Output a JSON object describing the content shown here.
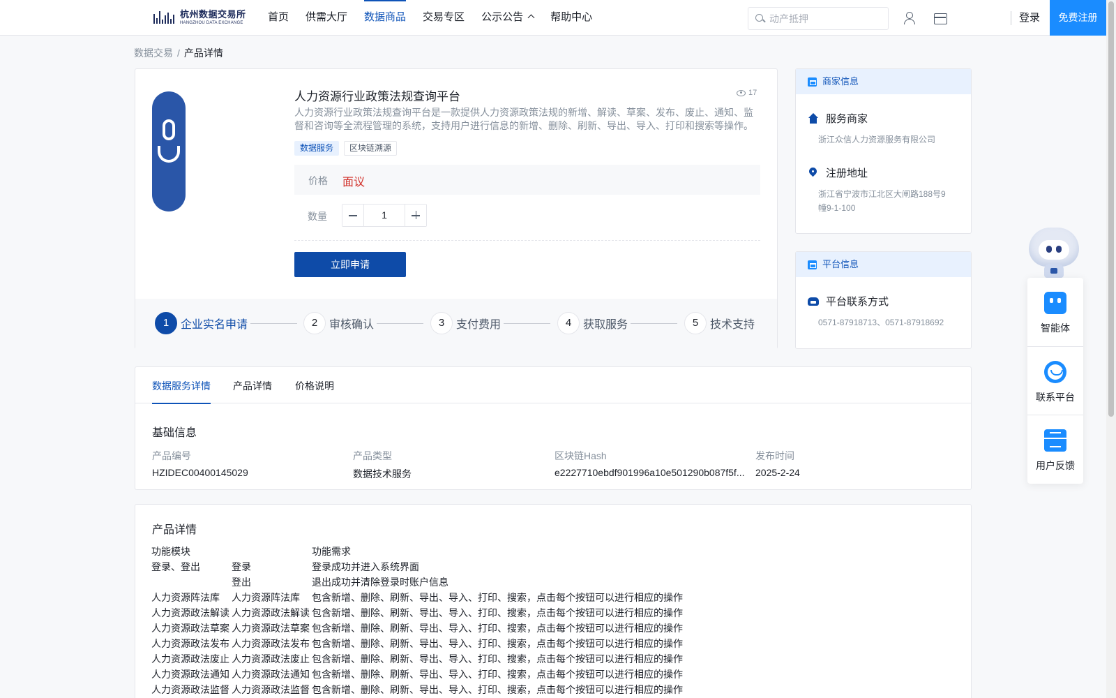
{
  "header": {
    "logo": {
      "cn": "杭州数据交易所",
      "en": "HANGZHOU DATA EXCHANGE"
    },
    "nav": [
      {
        "label": "首页"
      },
      {
        "label": "供需大厅"
      },
      {
        "label": "数据商品",
        "active": true
      },
      {
        "label": "交易专区"
      },
      {
        "label": "公示公告"
      },
      {
        "label": "帮助中心"
      }
    ],
    "search": {
      "placeholder": "动产抵押",
      "value": ""
    },
    "login": "登录",
    "register": "免费注册",
    "accent_color": "#0e53b8",
    "register_color": "#1a8cff"
  },
  "breadcrumb": {
    "root": "数据交易",
    "separator": "/",
    "current": "产品详情"
  },
  "product": {
    "title": "人力资源行业政策法规查询平台",
    "views": "17",
    "description": "人力资源行业政策法规查询平台是一款提供人力资源政策法规的新增、解读、草案、发布、废止、通知、监督和咨询等全流程管理的系统，支持用户进行信息的新增、删除、刷新、导出、导入、打印和搜索等操作。",
    "tags": [
      "数据服务",
      "区块链溯源"
    ],
    "price_label": "价格",
    "price_value": "面议",
    "price_color": "#d2312a",
    "quantity_label": "数量",
    "quantity": "1",
    "apply_button": "立即申请",
    "steps": [
      {
        "num": "1",
        "label": "企业实名申请",
        "active": true
      },
      {
        "num": "2",
        "label": "审核确认"
      },
      {
        "num": "3",
        "label": "支付费用"
      },
      {
        "num": "4",
        "label": "获取服务"
      },
      {
        "num": "5",
        "label": "技术支持"
      }
    ]
  },
  "merchant": {
    "heading": "商家信息",
    "service_title": "服务商家",
    "service_value": "浙江众信人力资源服务有限公司",
    "address_title": "注册地址",
    "address_value": "浙江省宁波市江北区大闸路188号9幢9-1-100"
  },
  "platform": {
    "heading": "平台信息",
    "contact_title": "平台联系方式",
    "contact_value": "0571-87918713、0571-87918692"
  },
  "float_widget": {
    "items": [
      {
        "label": "智能体",
        "icon": "agent-icon"
      },
      {
        "label": "联系平台",
        "icon": "headset-icon"
      },
      {
        "label": "用户反馈",
        "icon": "feedback-icon"
      }
    ]
  },
  "details": {
    "tabs": [
      "数据服务详情",
      "产品详情",
      "价格说明"
    ],
    "basic_title": "基础信息",
    "fields": [
      {
        "label": "产品编号",
        "value": "HZIDEC00400145029"
      },
      {
        "label": "产品类型",
        "value": "数据技术服务"
      },
      {
        "label": "区块链Hash",
        "value": "e2227710ebdf901996a10e501290b087f5f..."
      },
      {
        "label": "发布时间",
        "value": "2025-2-24"
      }
    ]
  },
  "product_detail": {
    "title": "产品详情",
    "rows": [
      [
        "功能模块",
        "",
        "功能需求"
      ],
      [
        "登录、登出",
        "登录",
        "登录成功并进入系统界面"
      ],
      [
        "",
        "登出",
        "退出成功并清除登录时账户信息"
      ],
      [
        "人力资源阵法库",
        "人力资源阵法库",
        "包含新增、删除、刷新、导出、导入、打印、搜索，点击每个按钮可以进行相应的操作"
      ],
      [
        "人力资源政法解读",
        "人力资源政法解读",
        "包含新增、删除、刷新、导出、导入、打印、搜索，点击每个按钮可以进行相应的操作"
      ],
      [
        "人力资源政法草案",
        "人力资源政法草案",
        "包含新增、删除、刷新、导出、导入、打印、搜索，点击每个按钮可以进行相应的操作"
      ],
      [
        "人力资源政法发布",
        "人力资源政法发布",
        "包含新增、删除、刷新、导出、导入、打印、搜索，点击每个按钮可以进行相应的操作"
      ],
      [
        "人力资源政法废止",
        "人力资源政法废止",
        "包含新增、删除、刷新、导出、导入、打印、搜索，点击每个按钮可以进行相应的操作"
      ],
      [
        "人力资源政法通知",
        "人力资源政法通知",
        "包含新增、删除、刷新、导出、导入、打印、搜索，点击每个按钮可以进行相应的操作"
      ],
      [
        "人力资源政法监督",
        "人力资源政法监督",
        "包含新增、删除、刷新、导出、导入、打印、搜索，点击每个按钮可以进行相应的操作"
      ]
    ]
  }
}
